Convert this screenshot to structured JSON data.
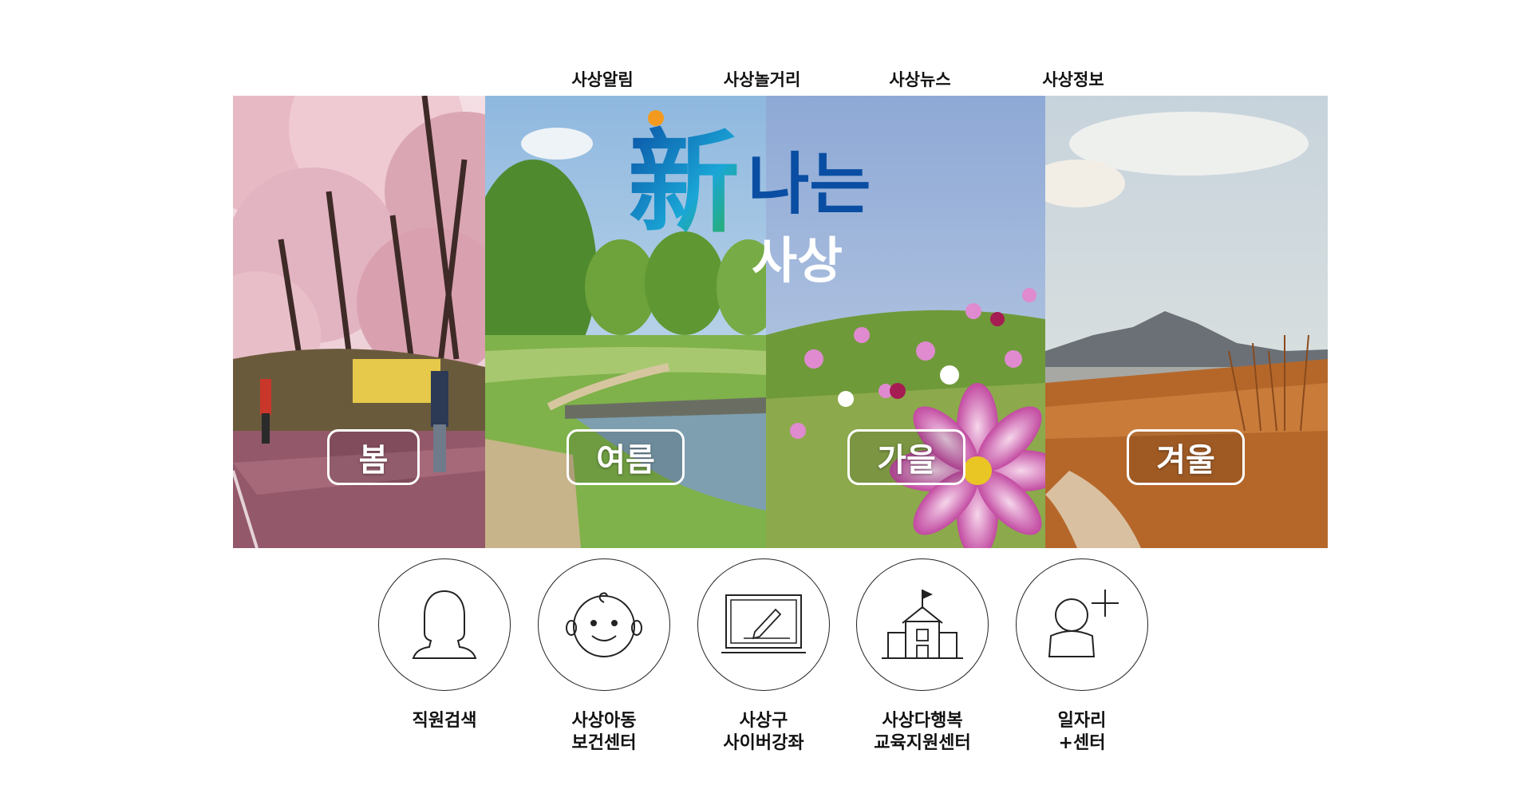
{
  "top_nav": {
    "items": [
      {
        "label": "사상알림"
      },
      {
        "label": "사상놀거리"
      },
      {
        "label": "사상뉴스"
      },
      {
        "label": "사상정보"
      }
    ]
  },
  "hero": {
    "logo": {
      "hanja": "新",
      "line1": "나는",
      "line2": "사상"
    },
    "seasons": [
      {
        "label": "봄"
      },
      {
        "label": "여름"
      },
      {
        "label": "가을"
      },
      {
        "label": "겨울"
      }
    ]
  },
  "quick_links": [
    {
      "label": "직원검색",
      "icon": "person-silhouette-icon"
    },
    {
      "label": "사상아동\n보건센터",
      "icon": "baby-face-icon"
    },
    {
      "label": "사상구\n사이버강좌",
      "icon": "monitor-pen-icon"
    },
    {
      "label": "사상다행복\n교육지원센터",
      "icon": "school-house-icon"
    },
    {
      "label": "일자리\n+센터",
      "icon": "person-plus-icon"
    }
  ],
  "colors": {
    "logo_blue": "#0a4ea3",
    "logo_cyan": "#1aa6d6",
    "logo_green": "#2db34a",
    "logo_orange": "#f39a1e",
    "spring_path": "#8a4f5e",
    "winter_reeds": "#b5672a"
  }
}
